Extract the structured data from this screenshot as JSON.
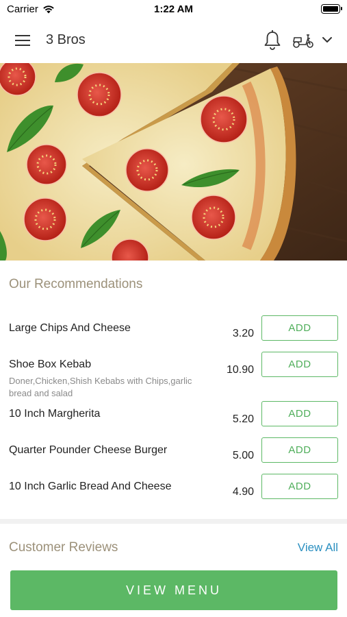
{
  "status_bar": {
    "carrier": "Carrier",
    "time": "1:22 AM"
  },
  "navbar": {
    "title": "3 Bros",
    "icons": [
      "hamburger-menu-icon",
      "bell-icon",
      "scooter-delivery-icon",
      "chevron-down-icon"
    ]
  },
  "recommendations": {
    "title": "Our Recommendations",
    "add_label": "ADD",
    "items": [
      {
        "name": "Large Chips And Cheese",
        "description": "",
        "price": "3.20"
      },
      {
        "name": "Shoe Box Kebab",
        "description": "Doner,Chicken,Shish Kebabs with Chips,garlic bread and salad",
        "price": "10.90"
      },
      {
        "name": "10 Inch Margherita",
        "description": "",
        "price": "5.20"
      },
      {
        "name": "Quarter Pounder Cheese Burger",
        "description": "",
        "price": "5.00"
      },
      {
        "name": "10 Inch Garlic Bread And Cheese",
        "description": "",
        "price": "4.90"
      }
    ]
  },
  "reviews": {
    "title": "Customer Reviews",
    "view_all_label": "View All"
  },
  "footer": {
    "view_menu_label": "VIEW MENU"
  },
  "colors": {
    "accent_green": "#5cb865",
    "section_title": "#9c917a",
    "link_blue": "#2a8fc0"
  }
}
